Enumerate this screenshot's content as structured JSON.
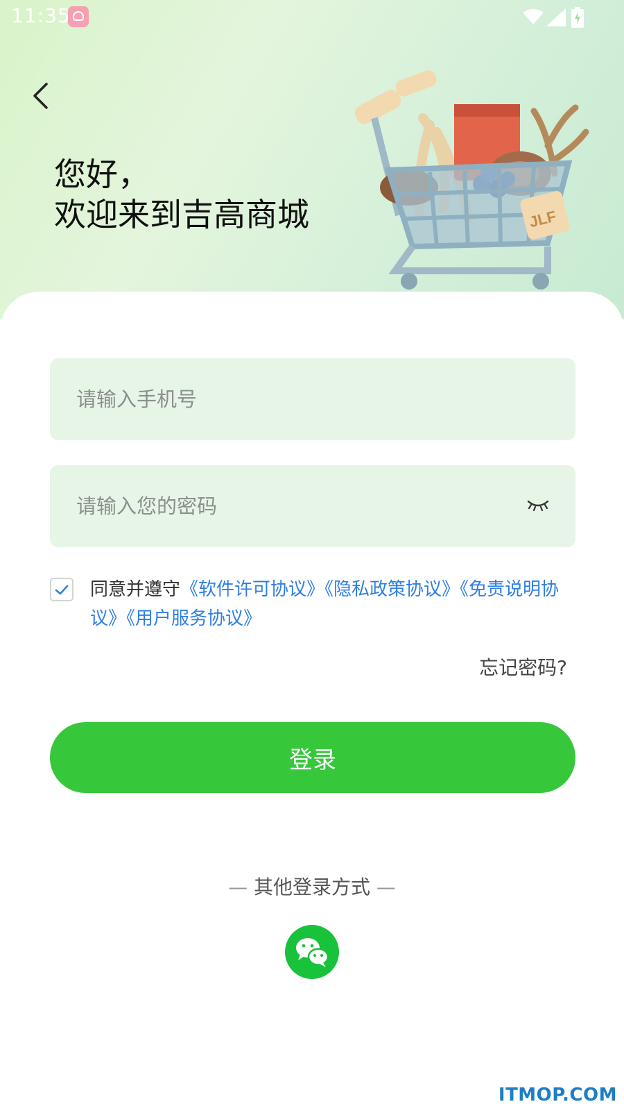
{
  "status_bar": {
    "time": "11:35"
  },
  "header": {
    "greeting_line1": "您好，",
    "greeting_line2": "欢迎来到吉高商城",
    "cart_label": "JLF"
  },
  "form": {
    "phone_placeholder": "请输入手机号",
    "password_placeholder": "请输入您的密码",
    "agreement_prefix": "同意并遵守",
    "agreement_links": [
      "《软件许可协议》",
      "《隐私政策协议》",
      "《免责说明协议》",
      "《用户服务协议》"
    ],
    "agreement_checked": true,
    "forgot_password": "忘记密码?",
    "login_label": "登录"
  },
  "other_login": {
    "label": "其他登录方式",
    "methods": [
      "wechat"
    ]
  },
  "watermark": "ITMOP.COM",
  "colors": {
    "accent": "#37c73b",
    "link": "#2e7fe3",
    "field_bg": "#e7f5e6",
    "wechat": "#19c23b"
  }
}
